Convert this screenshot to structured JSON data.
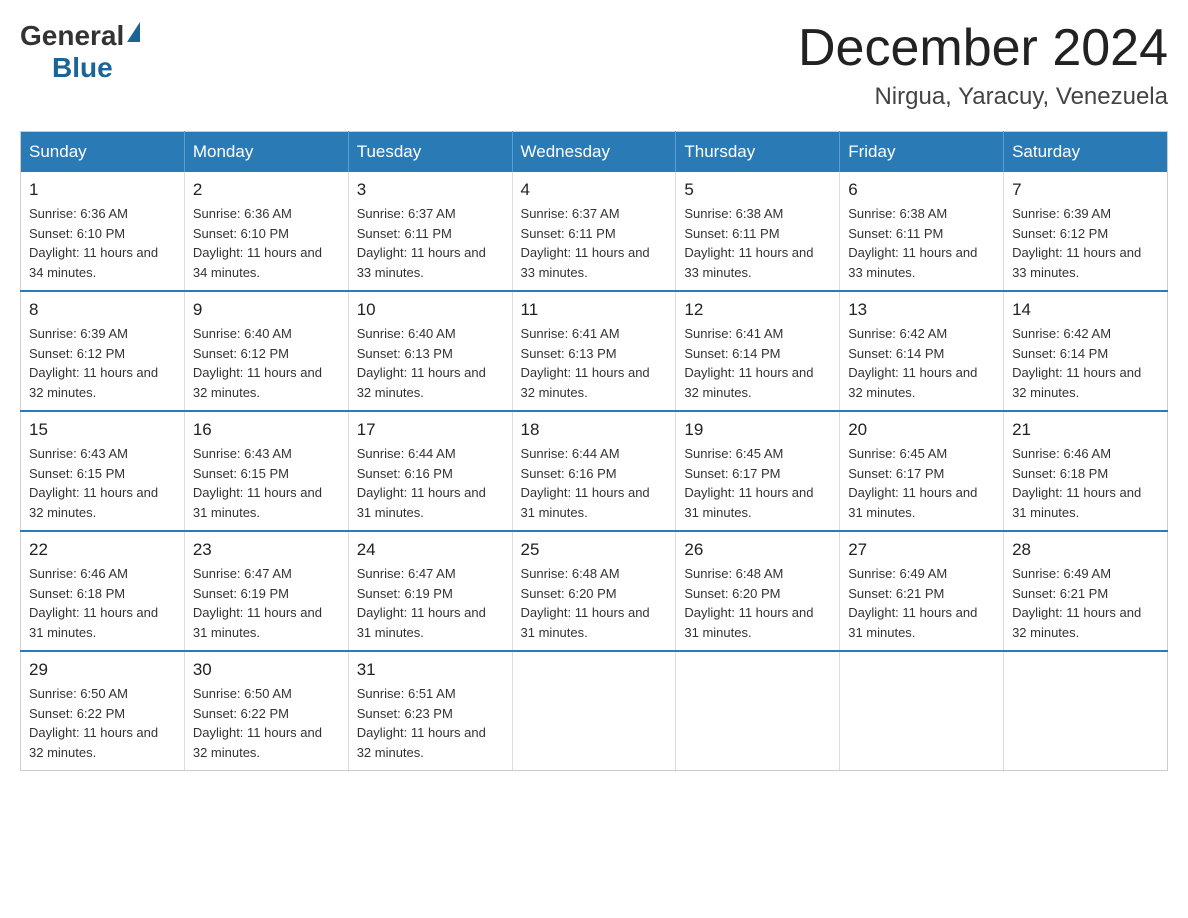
{
  "header": {
    "logo": {
      "general": "General",
      "blue": "Blue"
    },
    "title": "December 2024",
    "location": "Nirgua, Yaracuy, Venezuela"
  },
  "calendar": {
    "days_of_week": [
      "Sunday",
      "Monday",
      "Tuesday",
      "Wednesday",
      "Thursday",
      "Friday",
      "Saturday"
    ],
    "weeks": [
      [
        {
          "day": "1",
          "sunrise": "6:36 AM",
          "sunset": "6:10 PM",
          "daylight": "11 hours and 34 minutes."
        },
        {
          "day": "2",
          "sunrise": "6:36 AM",
          "sunset": "6:10 PM",
          "daylight": "11 hours and 34 minutes."
        },
        {
          "day": "3",
          "sunrise": "6:37 AM",
          "sunset": "6:11 PM",
          "daylight": "11 hours and 33 minutes."
        },
        {
          "day": "4",
          "sunrise": "6:37 AM",
          "sunset": "6:11 PM",
          "daylight": "11 hours and 33 minutes."
        },
        {
          "day": "5",
          "sunrise": "6:38 AM",
          "sunset": "6:11 PM",
          "daylight": "11 hours and 33 minutes."
        },
        {
          "day": "6",
          "sunrise": "6:38 AM",
          "sunset": "6:11 PM",
          "daylight": "11 hours and 33 minutes."
        },
        {
          "day": "7",
          "sunrise": "6:39 AM",
          "sunset": "6:12 PM",
          "daylight": "11 hours and 33 minutes."
        }
      ],
      [
        {
          "day": "8",
          "sunrise": "6:39 AM",
          "sunset": "6:12 PM",
          "daylight": "11 hours and 32 minutes."
        },
        {
          "day": "9",
          "sunrise": "6:40 AM",
          "sunset": "6:12 PM",
          "daylight": "11 hours and 32 minutes."
        },
        {
          "day": "10",
          "sunrise": "6:40 AM",
          "sunset": "6:13 PM",
          "daylight": "11 hours and 32 minutes."
        },
        {
          "day": "11",
          "sunrise": "6:41 AM",
          "sunset": "6:13 PM",
          "daylight": "11 hours and 32 minutes."
        },
        {
          "day": "12",
          "sunrise": "6:41 AM",
          "sunset": "6:14 PM",
          "daylight": "11 hours and 32 minutes."
        },
        {
          "day": "13",
          "sunrise": "6:42 AM",
          "sunset": "6:14 PM",
          "daylight": "11 hours and 32 minutes."
        },
        {
          "day": "14",
          "sunrise": "6:42 AM",
          "sunset": "6:14 PM",
          "daylight": "11 hours and 32 minutes."
        }
      ],
      [
        {
          "day": "15",
          "sunrise": "6:43 AM",
          "sunset": "6:15 PM",
          "daylight": "11 hours and 32 minutes."
        },
        {
          "day": "16",
          "sunrise": "6:43 AM",
          "sunset": "6:15 PM",
          "daylight": "11 hours and 31 minutes."
        },
        {
          "day": "17",
          "sunrise": "6:44 AM",
          "sunset": "6:16 PM",
          "daylight": "11 hours and 31 minutes."
        },
        {
          "day": "18",
          "sunrise": "6:44 AM",
          "sunset": "6:16 PM",
          "daylight": "11 hours and 31 minutes."
        },
        {
          "day": "19",
          "sunrise": "6:45 AM",
          "sunset": "6:17 PM",
          "daylight": "11 hours and 31 minutes."
        },
        {
          "day": "20",
          "sunrise": "6:45 AM",
          "sunset": "6:17 PM",
          "daylight": "11 hours and 31 minutes."
        },
        {
          "day": "21",
          "sunrise": "6:46 AM",
          "sunset": "6:18 PM",
          "daylight": "11 hours and 31 minutes."
        }
      ],
      [
        {
          "day": "22",
          "sunrise": "6:46 AM",
          "sunset": "6:18 PM",
          "daylight": "11 hours and 31 minutes."
        },
        {
          "day": "23",
          "sunrise": "6:47 AM",
          "sunset": "6:19 PM",
          "daylight": "11 hours and 31 minutes."
        },
        {
          "day": "24",
          "sunrise": "6:47 AM",
          "sunset": "6:19 PM",
          "daylight": "11 hours and 31 minutes."
        },
        {
          "day": "25",
          "sunrise": "6:48 AM",
          "sunset": "6:20 PM",
          "daylight": "11 hours and 31 minutes."
        },
        {
          "day": "26",
          "sunrise": "6:48 AM",
          "sunset": "6:20 PM",
          "daylight": "11 hours and 31 minutes."
        },
        {
          "day": "27",
          "sunrise": "6:49 AM",
          "sunset": "6:21 PM",
          "daylight": "11 hours and 31 minutes."
        },
        {
          "day": "28",
          "sunrise": "6:49 AM",
          "sunset": "6:21 PM",
          "daylight": "11 hours and 32 minutes."
        }
      ],
      [
        {
          "day": "29",
          "sunrise": "6:50 AM",
          "sunset": "6:22 PM",
          "daylight": "11 hours and 32 minutes."
        },
        {
          "day": "30",
          "sunrise": "6:50 AM",
          "sunset": "6:22 PM",
          "daylight": "11 hours and 32 minutes."
        },
        {
          "day": "31",
          "sunrise": "6:51 AM",
          "sunset": "6:23 PM",
          "daylight": "11 hours and 32 minutes."
        },
        null,
        null,
        null,
        null
      ]
    ]
  }
}
